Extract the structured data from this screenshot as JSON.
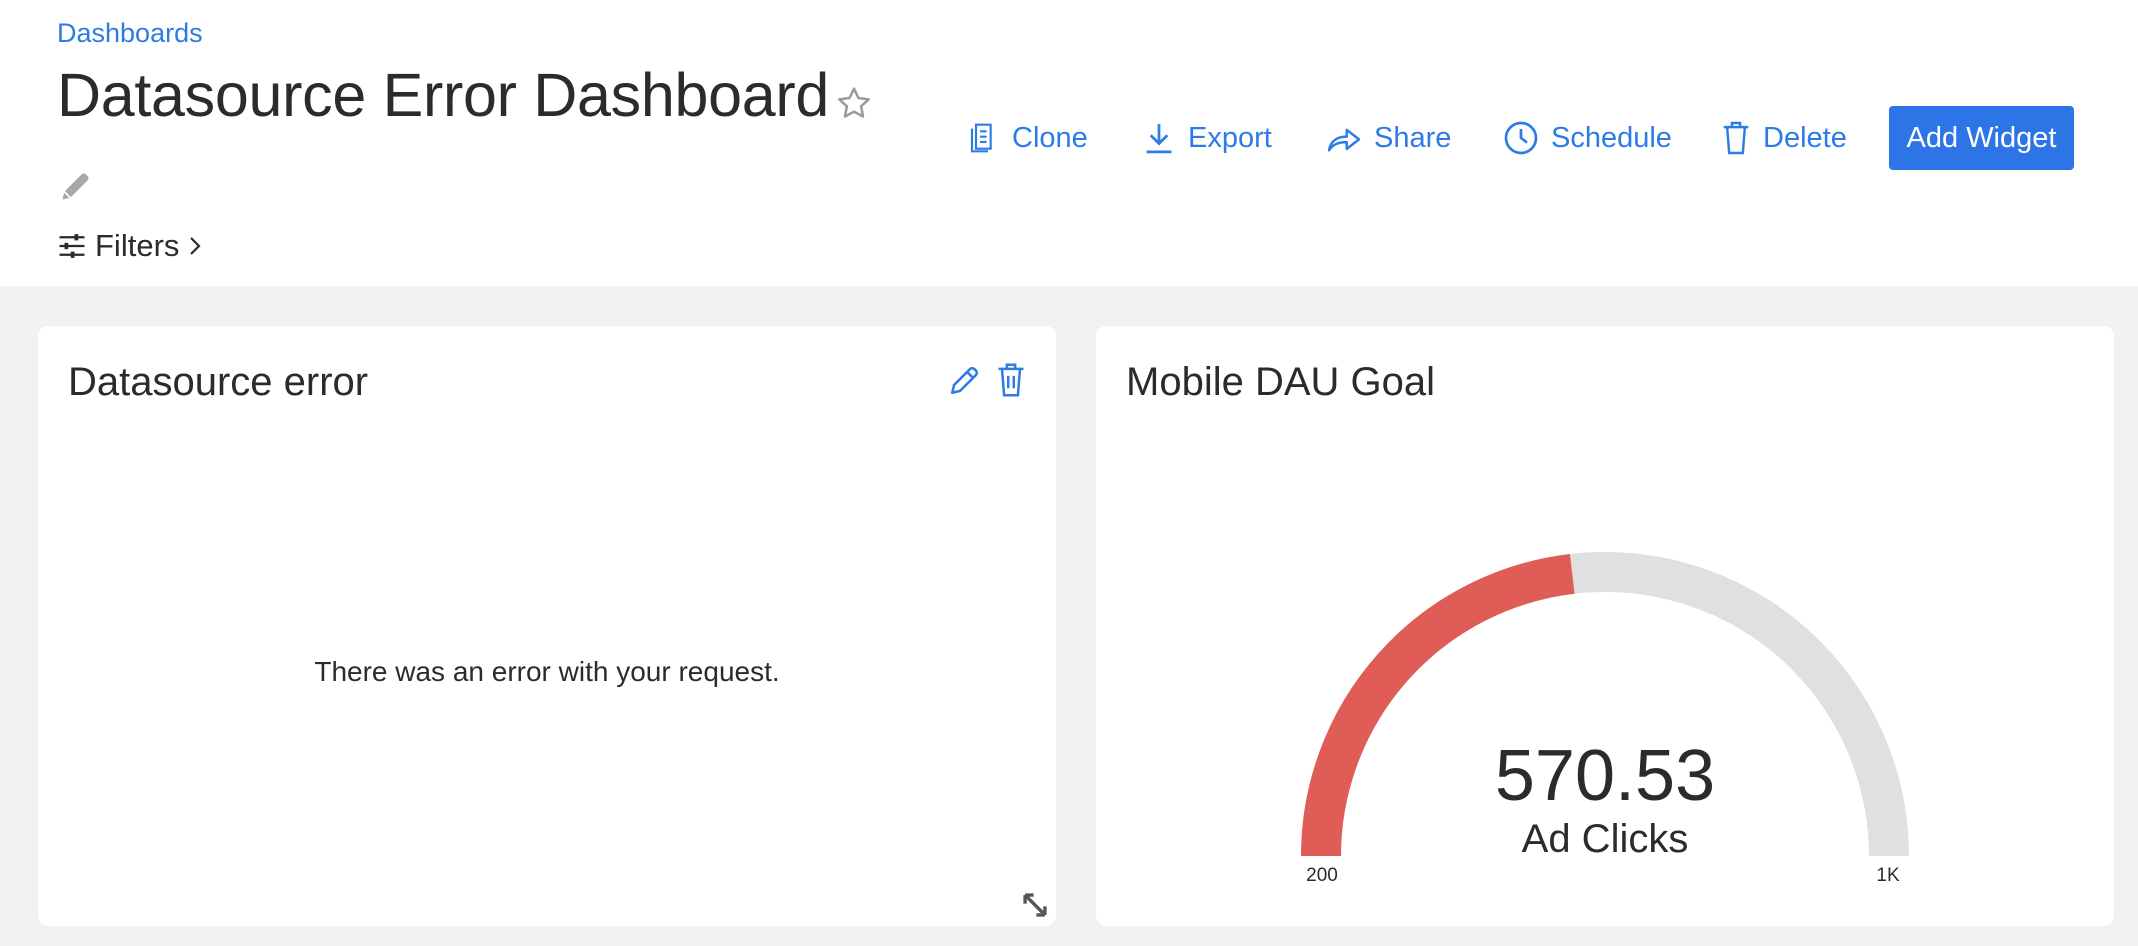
{
  "header": {
    "breadcrumb": "Dashboards",
    "title": "Datasource Error Dashboard",
    "filters_label": "Filters"
  },
  "toolbar": {
    "clone": "Clone",
    "export": "Export",
    "share": "Share",
    "schedule": "Schedule",
    "delete": "Delete",
    "add_widget": "Add Widget"
  },
  "widgets": {
    "error_widget": {
      "title": "Datasource error",
      "message": "There was an error with your request."
    },
    "gauge_widget": {
      "title": "Mobile DAU Goal",
      "value_label": "570.53",
      "unit": "Ad Clicks",
      "min_label": "200",
      "max_label": "1K"
    }
  },
  "chart_data": {
    "type": "gauge",
    "title": "Mobile DAU Goal",
    "value": 570.53,
    "min": 200,
    "max": 1000,
    "unit": "Ad Clicks",
    "colors": {
      "fill": "#e05c56",
      "track": "#e0e0e0"
    }
  },
  "colors": {
    "accent": "#2d7be5",
    "primary_button": "#2d74e7",
    "canvas_bg": "#f2f2f2"
  }
}
